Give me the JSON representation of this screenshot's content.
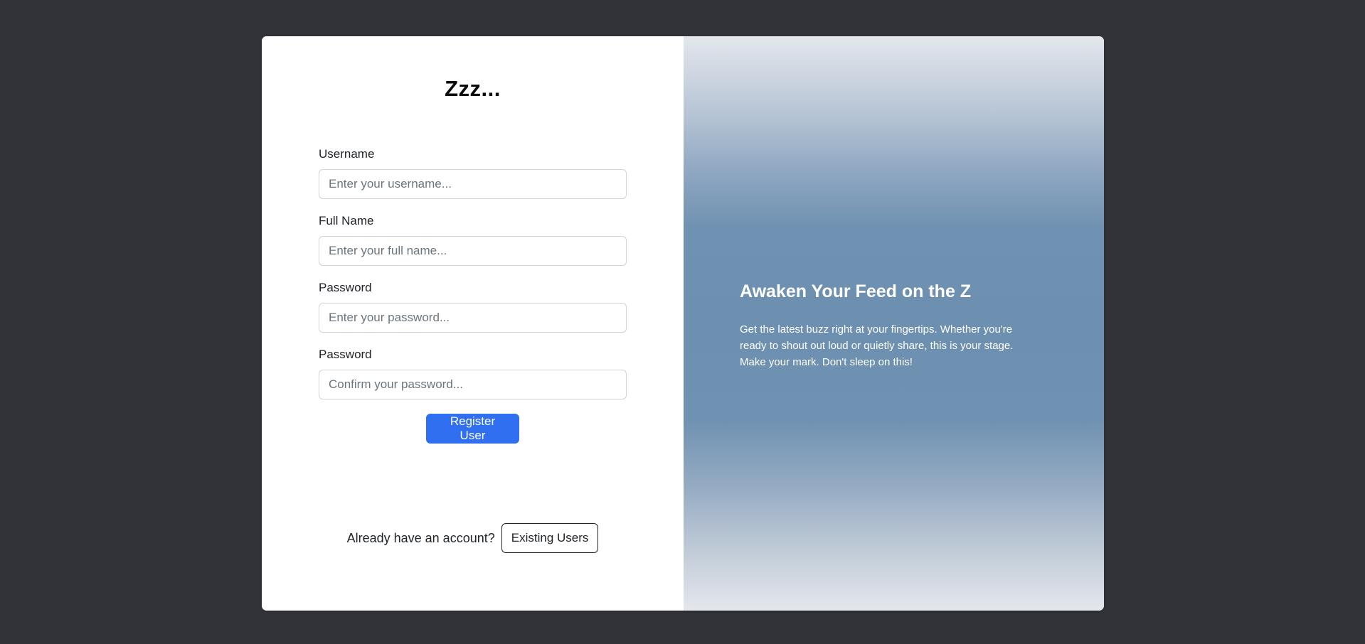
{
  "app": {
    "title": "Zzz..."
  },
  "form": {
    "fields": [
      {
        "label": "Username",
        "placeholder": "Enter your username...",
        "type": "text"
      },
      {
        "label": "Full Name",
        "placeholder": "Enter your full name...",
        "type": "text"
      },
      {
        "label": "Password",
        "placeholder": "Enter your password...",
        "type": "password"
      },
      {
        "label": "Password",
        "placeholder": "Confirm your password...",
        "type": "password"
      }
    ],
    "register_label": "Register User"
  },
  "existing": {
    "prompt": "Already have an account?",
    "button_label": "Existing Users"
  },
  "promo": {
    "heading": "Awaken Your Feed on the Z",
    "body": "Get the latest buzz right at your fingertips. Whether you're ready to shout out loud or quietly share, this is your stage. Make your mark. Don't sleep on this!"
  },
  "colors": {
    "page_background": "#313338",
    "primary": "#2f6ff0",
    "panel_accent": "#6e90b0"
  }
}
